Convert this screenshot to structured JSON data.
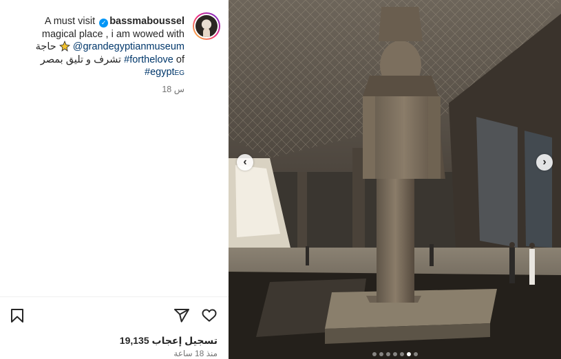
{
  "post": {
    "username": "bassmaboussel",
    "caption_line1": "A must visit",
    "caption_line2": "magical place , i am wowed with",
    "caption_line3": "حاجة",
    "mention": "@grandegyptianmuseum",
    "hashtag1": "#forthelove",
    "caption_line4_ar": "تشرف و تليق بمصر",
    "of_word": "of",
    "hashtag2": "#egypt",
    "hashtag2_suffix": "EG",
    "time_ago": "18 س"
  },
  "actions": {
    "likes": "19,135 تسجيل إعجاب",
    "post_date": "منذ 18 ساعة"
  },
  "media": {
    "prev_label": "‹",
    "next_label": "›",
    "dot_count": 7,
    "active_dot": 5
  },
  "icons": {
    "bookmark": "bookmark-icon",
    "send": "send-icon",
    "heart": "heart-icon",
    "verified": "verified-badge-icon"
  },
  "colors": {
    "link": "#00376b",
    "verified": "#0095f6",
    "muted": "#737373"
  }
}
